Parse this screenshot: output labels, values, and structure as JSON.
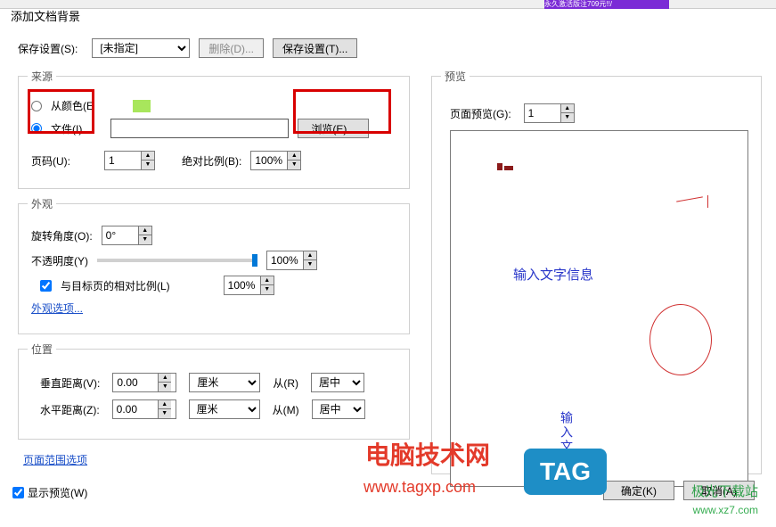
{
  "topstrip": {
    "purple_text": "永久激活版注709元!!/"
  },
  "dialog": {
    "title": "添加文档背景"
  },
  "save_settings": {
    "label": "保存设置(S):",
    "preset": "[未指定]",
    "delete_btn": "删除(D)...",
    "save_btn": "保存设置(T)..."
  },
  "source": {
    "legend": "来源",
    "from_color": "从颜色(E",
    "file": "文件(I)",
    "browse": "浏览(E)...",
    "page_label": "页码(U):",
    "page_value": "1",
    "scale_label": "绝对比例(B):",
    "scale_value": "100%"
  },
  "appearance": {
    "legend": "外观",
    "rotation_label": "旋转角度(O):",
    "rotation_value": "0°",
    "opacity_label": "不透明度(Y)",
    "opacity_value": "100%",
    "relative_chk": "与目标页的相对比例(L)",
    "relative_value": "100%",
    "options_link": "外观选项..."
  },
  "position": {
    "legend": "位置",
    "vdist_label": "垂直距离(V):",
    "vdist_value": "0.00",
    "hdist_label": "水平距离(Z):",
    "hdist_value": "0.00",
    "unit": "厘米",
    "from_r": "从(R)",
    "from_m": "从(M)",
    "center": "居中"
  },
  "page_range_link": "页面范围选项",
  "show_preview": "显示预览(W)",
  "preview": {
    "legend": "预览",
    "page_preview_label": "页面预览(G):",
    "page_value": "1",
    "text1": "输入文字信息",
    "text2": "输入文字"
  },
  "buttons": {
    "ok": "确定(K)",
    "cancel": "取消(A)"
  },
  "watermark": {
    "line1": "电脑技术网",
    "line2": "www.tagxp.com",
    "tag": "TAG",
    "xz7a": "极光下载站",
    "xz7b": "www.xz7.com"
  }
}
